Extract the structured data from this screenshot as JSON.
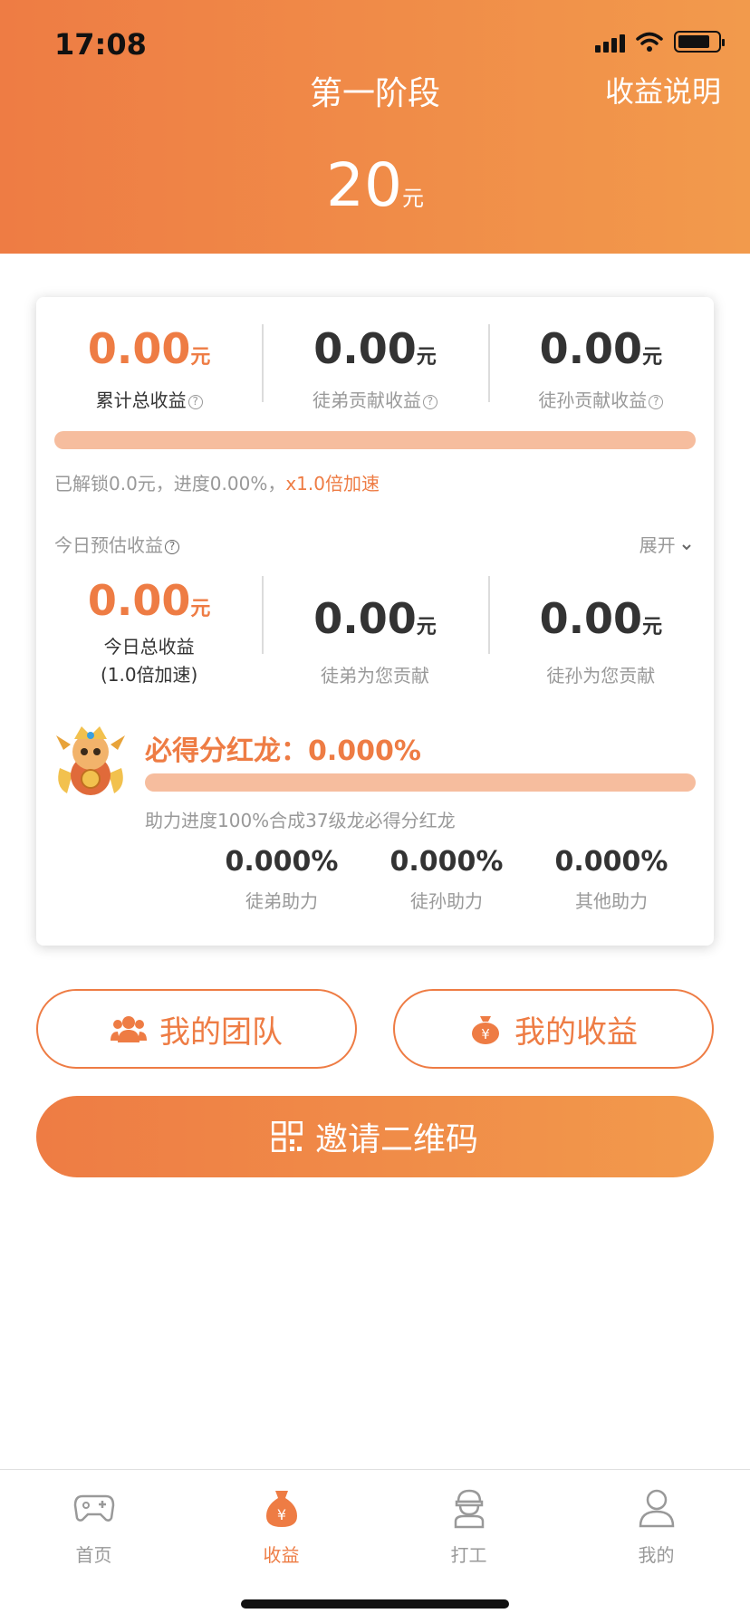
{
  "status_bar": {
    "time": "17:08"
  },
  "header": {
    "title": "第一阶段",
    "explain_link": "收益说明",
    "stage_amount": "20",
    "stage_unit": "元"
  },
  "summary": {
    "items": [
      {
        "value": "0.00",
        "unit": "元",
        "label": "累计总收益"
      },
      {
        "value": "0.00",
        "unit": "元",
        "label": "徒弟贡献收益"
      },
      {
        "value": "0.00",
        "unit": "元",
        "label": "徒孙贡献收益"
      }
    ],
    "progress_fraction": 0.0,
    "progress_prefix": "已解锁0.0元，进度0.00%，",
    "speed_text": "x1.0倍加速"
  },
  "today": {
    "label": "今日预估收益",
    "expand_label": "展开",
    "items": [
      {
        "value": "0.00",
        "unit": "元",
        "label": "今日总收益",
        "label2": "(1.0倍加速)"
      },
      {
        "value": "0.00",
        "unit": "元",
        "label": "徒弟为您贡献"
      },
      {
        "value": "0.00",
        "unit": "元",
        "label": "徒孙为您贡献"
      }
    ]
  },
  "dragon": {
    "title": "必得分红龙：0.000%",
    "progress_fraction": 0.0,
    "description": "助力进度100%合成37级龙必得分红龙",
    "assists": [
      {
        "value": "0.000%",
        "label": "徒弟助力"
      },
      {
        "value": "0.000%",
        "label": "徒孙助力"
      },
      {
        "value": "0.000%",
        "label": "其他助力"
      }
    ]
  },
  "buttons": {
    "team": "我的团队",
    "income": "我的收益",
    "invite": "邀请二维码"
  },
  "tabbar": {
    "items": [
      {
        "label": "首页",
        "icon": "gamepad-icon"
      },
      {
        "label": "收益",
        "icon": "money-bag-icon"
      },
      {
        "label": "打工",
        "icon": "worker-icon"
      },
      {
        "label": "我的",
        "icon": "user-icon"
      }
    ],
    "active_index": 1
  },
  "colors": {
    "accent": "#ee7c44",
    "accent_light": "#f6bd9e",
    "header_end": "#f29a4c"
  }
}
